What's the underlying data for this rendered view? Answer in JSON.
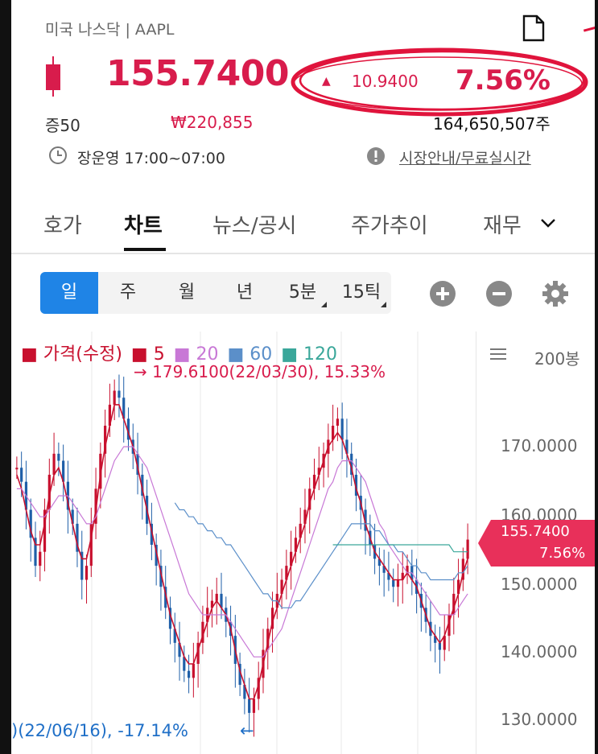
{
  "header": {
    "market": "미국 나스닥 | AAPL",
    "price": "155.7400",
    "change": "10.9400",
    "change_pct": "7.56%",
    "margin": "증50",
    "krw_price": "₩220,855",
    "volume": "164,650,507주",
    "trading_hours": "장운영 17:00~07:00",
    "market_guide_link": "시장안내/무료실시간",
    "up_color": "#d81c4c"
  },
  "tabs": [
    {
      "label": "호가"
    },
    {
      "label": "차트",
      "active": true
    },
    {
      "label": "뉴스/공시"
    },
    {
      "label": "주가추이"
    },
    {
      "label": "재무"
    }
  ],
  "toolbar": {
    "periods": [
      {
        "label": "일",
        "active": true
      },
      {
        "label": "주"
      },
      {
        "label": "월"
      },
      {
        "label": "년"
      },
      {
        "label": "5분"
      },
      {
        "label": "15틱"
      }
    ],
    "accent": "#1f84e6"
  },
  "chart": {
    "legend": [
      {
        "label": "가격(수정)",
        "color": "#c8102e"
      },
      {
        "label": "5",
        "color": "#c8102e"
      },
      {
        "label": "20",
        "color": "#c878d6"
      },
      {
        "label": "60",
        "color": "#5b8fc9"
      },
      {
        "label": "120",
        "color": "#3aa79a"
      }
    ],
    "max_marker": "→ 179.6100(22/03/30), 15.33%",
    "min_marker": ")(22/06/16), -17.14%",
    "min_arrow": "←",
    "bar_count_label": "200봉",
    "price_axis": [
      "170.0000",
      "160.0000",
      "150.0000",
      "140.0000",
      "130.0000"
    ],
    "current_price": "155.7400",
    "current_pct": "7.56%",
    "up_color": "#c8102e",
    "down_color": "#1f5fa8"
  },
  "chart_data": {
    "type": "candlestick",
    "ylim": [
      128,
      182
    ],
    "y_ticks": [
      130,
      140,
      150,
      160,
      170
    ],
    "current": 155.74,
    "series": [
      {
        "name": "가격(수정)",
        "values": [
          166,
          164,
          160,
          156,
          152,
          154,
          160,
          165,
          168,
          167,
          164,
          160,
          158,
          154,
          150,
          152,
          158,
          163,
          168,
          172,
          175,
          177,
          176,
          173,
          170,
          168,
          165,
          162,
          158,
          155,
          152,
          149,
          146,
          143,
          141,
          139,
          137,
          136,
          138,
          141,
          144,
          146,
          147,
          148,
          146,
          144,
          142,
          138,
          135,
          133,
          131,
          133,
          136,
          140,
          143,
          146,
          148,
          150,
          152,
          154,
          156,
          158,
          160,
          163,
          165,
          166,
          168,
          170,
          172,
          173,
          170,
          168,
          165,
          162,
          160,
          157,
          155,
          153,
          152,
          151,
          150,
          149,
          150,
          151,
          152,
          150,
          148,
          146,
          144,
          142,
          141,
          140,
          142,
          145,
          148,
          150,
          153,
          155.74
        ]
      },
      {
        "name": "5",
        "values": [
          165,
          163,
          160,
          157,
          155,
          155,
          158,
          162,
          165,
          166,
          164,
          161,
          158,
          155,
          153,
          153,
          156,
          160,
          165,
          169,
          172,
          175,
          175,
          173,
          171,
          169,
          166,
          163,
          160,
          157,
          154,
          151,
          148,
          145,
          143,
          141,
          139,
          138,
          138,
          140,
          142,
          144,
          146,
          147,
          146,
          145,
          143,
          140,
          137,
          135,
          133,
          133,
          135,
          138,
          141,
          144,
          146,
          148,
          150,
          152,
          154,
          156,
          158,
          161,
          163,
          165,
          167,
          169,
          170,
          171,
          170,
          168,
          166,
          163,
          161,
          158,
          156,
          154,
          153,
          152,
          151,
          150,
          150,
          150,
          151,
          150,
          149,
          147,
          145,
          143,
          142,
          141,
          142,
          144,
          146,
          148,
          151,
          153
        ]
      },
      {
        "name": "20",
        "values": [
          163,
          163,
          162,
          161,
          160,
          159,
          159,
          160,
          161,
          162,
          162,
          162,
          161,
          160,
          159,
          158,
          158,
          159,
          161,
          163,
          165,
          167,
          168,
          169,
          169,
          169,
          168,
          167,
          166,
          164,
          162,
          160,
          158,
          156,
          154,
          152,
          150,
          148,
          147,
          146,
          145,
          145,
          145,
          145,
          145,
          145,
          144,
          143,
          142,
          141,
          140,
          139,
          139,
          139,
          140,
          141,
          142,
          143,
          145,
          147,
          149,
          151,
          153,
          155,
          157,
          159,
          161,
          163,
          164,
          166,
          167,
          167,
          167,
          166,
          165,
          164,
          162,
          160,
          158,
          157,
          155,
          154,
          153,
          152,
          151,
          151,
          150,
          149,
          148,
          147,
          146,
          145,
          145,
          145,
          145,
          146,
          147,
          148
        ]
      },
      {
        "name": "60",
        "values": [
          null,
          null,
          null,
          null,
          null,
          null,
          null,
          null,
          null,
          null,
          null,
          null,
          null,
          null,
          null,
          null,
          null,
          null,
          null,
          null,
          null,
          null,
          null,
          null,
          null,
          null,
          null,
          null,
          null,
          null,
          null,
          null,
          null,
          null,
          161,
          160,
          160,
          159,
          159,
          158,
          158,
          157,
          157,
          156,
          156,
          155,
          155,
          154,
          153,
          152,
          151,
          150,
          149,
          148,
          148,
          147,
          147,
          146,
          146,
          146,
          147,
          147,
          148,
          149,
          150,
          151,
          152,
          153,
          154,
          155,
          156,
          157,
          158,
          158,
          158,
          158,
          158,
          157,
          157,
          156,
          155,
          155,
          154,
          154,
          153,
          152,
          152,
          151,
          151,
          150,
          150,
          150,
          150,
          150,
          150,
          151,
          151,
          152
        ]
      },
      {
        "name": "120",
        "values": [
          null,
          null,
          null,
          null,
          null,
          null,
          null,
          null,
          null,
          null,
          null,
          null,
          null,
          null,
          null,
          null,
          null,
          null,
          null,
          null,
          null,
          null,
          null,
          null,
          null,
          null,
          null,
          null,
          null,
          null,
          null,
          null,
          null,
          null,
          null,
          null,
          null,
          null,
          null,
          null,
          null,
          null,
          null,
          null,
          null,
          null,
          null,
          null,
          null,
          null,
          null,
          null,
          null,
          null,
          null,
          null,
          null,
          null,
          null,
          null,
          null,
          null,
          null,
          null,
          null,
          null,
          null,
          null,
          155,
          155,
          155,
          155,
          155,
          155,
          155,
          155,
          155,
          155,
          155,
          155,
          155,
          155,
          155,
          155,
          155,
          155,
          155,
          155,
          155,
          155,
          155,
          155,
          155,
          155,
          154,
          154,
          154,
          154
        ]
      }
    ],
    "max": {
      "value": 179.61,
      "date": "22/03/30",
      "pct": "15.33%"
    },
    "min": {
      "date": "22/06/16",
      "pct": "-17.14%"
    }
  }
}
